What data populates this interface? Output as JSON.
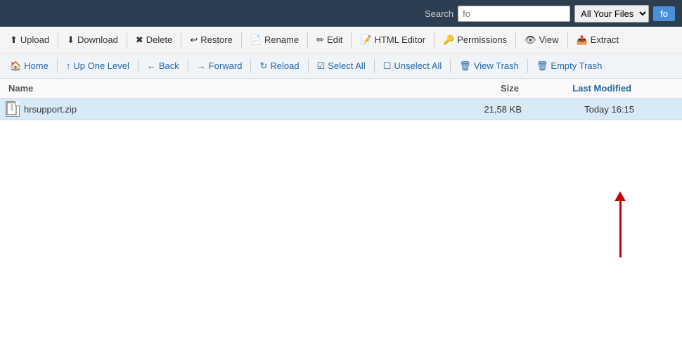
{
  "search": {
    "label": "Search",
    "placeholder": "fo",
    "scope_options": [
      "All Your Files"
    ],
    "scope_selected": "All Your Files",
    "go_label": "fo"
  },
  "toolbar": {
    "buttons": [
      {
        "id": "upload",
        "icon": "⬆",
        "label": "Upload"
      },
      {
        "id": "download",
        "icon": "⬇",
        "label": "Download"
      },
      {
        "id": "delete",
        "icon": "✖",
        "label": "Delete"
      },
      {
        "id": "restore",
        "icon": "↩",
        "label": "Restore"
      },
      {
        "id": "rename",
        "icon": "📄",
        "label": "Rename"
      },
      {
        "id": "edit",
        "icon": "✏",
        "label": "Edit"
      },
      {
        "id": "html-editor",
        "icon": "📝",
        "label": "HTML Editor"
      },
      {
        "id": "permissions",
        "icon": "🔑",
        "label": "Permissions"
      },
      {
        "id": "view",
        "icon": "👁",
        "label": "View"
      },
      {
        "id": "extract",
        "icon": "📤",
        "label": "Extract"
      }
    ]
  },
  "navbar": {
    "buttons": [
      {
        "id": "home",
        "icon": "🏠",
        "label": "Home"
      },
      {
        "id": "up-one-level",
        "icon": "↑",
        "label": "Up One Level"
      },
      {
        "id": "back",
        "icon": "←",
        "label": "Back"
      },
      {
        "id": "forward",
        "icon": "→",
        "label": "Forward"
      },
      {
        "id": "reload",
        "icon": "↻",
        "label": "Reload"
      },
      {
        "id": "select-all",
        "icon": "☑",
        "label": "Select All"
      },
      {
        "id": "unselect-all",
        "icon": "☐",
        "label": "Unselect All"
      },
      {
        "id": "view-trash",
        "icon": "🗑",
        "label": "View Trash"
      },
      {
        "id": "empty-trash",
        "icon": "🗑",
        "label": "Empty Trash"
      }
    ]
  },
  "file_list": {
    "columns": {
      "name": "Name",
      "size": "Size",
      "last_modified": "Last Modified",
      "permissions": ""
    },
    "rows": [
      {
        "name": "hrsupport.zip",
        "size": "21,58 KB",
        "last_modified": "Today 16:15",
        "permissions": ""
      }
    ]
  }
}
